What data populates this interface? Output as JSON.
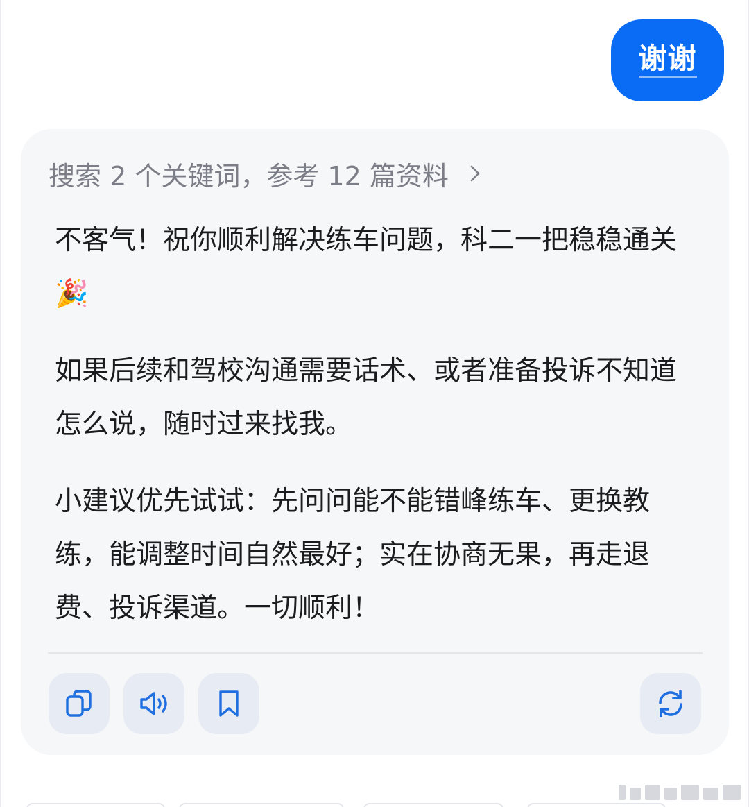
{
  "user_message": {
    "text": "谢谢"
  },
  "assistant": {
    "search_summary": "搜索 2 个关键词，参考 12 篇资料",
    "paragraphs": [
      "不客气！祝你顺利解决练车问题，科二一把稳稳通关🎉",
      "如果后续和驾校沟通需要话术、或者准备投诉不知道怎么说，随时过来找我。",
      "小建议优先试试：先问问能不能错峰练车、更换教练，能调整时间自然最好；实在协商无果，再走退费、投诉渠道。一切顺利！"
    ],
    "actions": [
      {
        "name": "copy",
        "icon": "copy-icon"
      },
      {
        "name": "read-aloud",
        "icon": "speaker-icon"
      },
      {
        "name": "bookmark",
        "icon": "bookmark-icon"
      },
      {
        "name": "regenerate",
        "icon": "refresh-icon"
      }
    ]
  },
  "colors": {
    "accent": "#0a6cf5",
    "icon": "#1f6fe0",
    "card_bg": "#f6f7f9",
    "action_bg": "#e7ebf4",
    "text": "#1b1c1f",
    "muted": "#7b7e86"
  }
}
